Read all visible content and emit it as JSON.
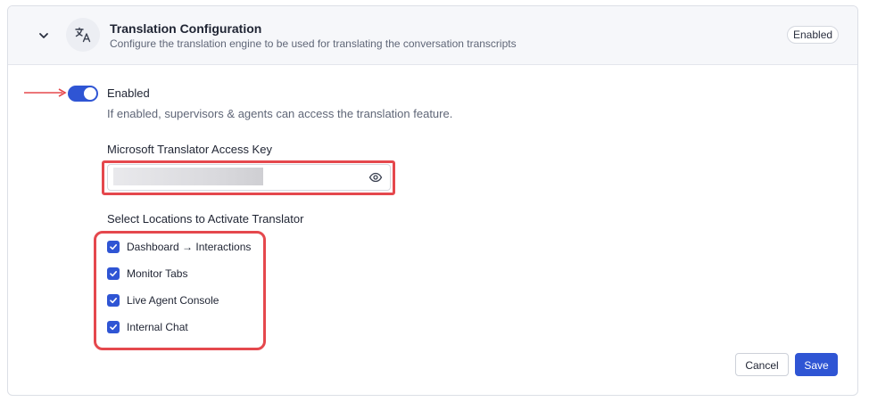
{
  "header": {
    "title": "Translation Configuration",
    "subtitle": "Configure the translation engine to be used for translating the conversation transcripts",
    "status_badge": "Enabled",
    "icon": "translate-icon",
    "collapse_icon": "chevron-down-icon"
  },
  "toggle": {
    "label": "Enabled",
    "description": "If enabled, supervisors & agents can access the translation feature.",
    "checked": true
  },
  "access_key": {
    "label": "Microsoft Translator Access Key",
    "value": "",
    "masked": true,
    "visibility_icon": "eye-icon"
  },
  "locations": {
    "label": "Select Locations to Activate Translator",
    "items": [
      {
        "label": "Dashboard → Interactions",
        "checked": true
      },
      {
        "label": "Monitor Tabs",
        "checked": true
      },
      {
        "label": "Live Agent Console",
        "checked": true
      },
      {
        "label": "Internal Chat",
        "checked": true
      }
    ]
  },
  "actions": {
    "cancel_label": "Cancel",
    "save_label": "Save"
  },
  "colors": {
    "accent": "#2f55d4",
    "highlight": "#e5484d",
    "header_bg": "#f6f7fa"
  }
}
